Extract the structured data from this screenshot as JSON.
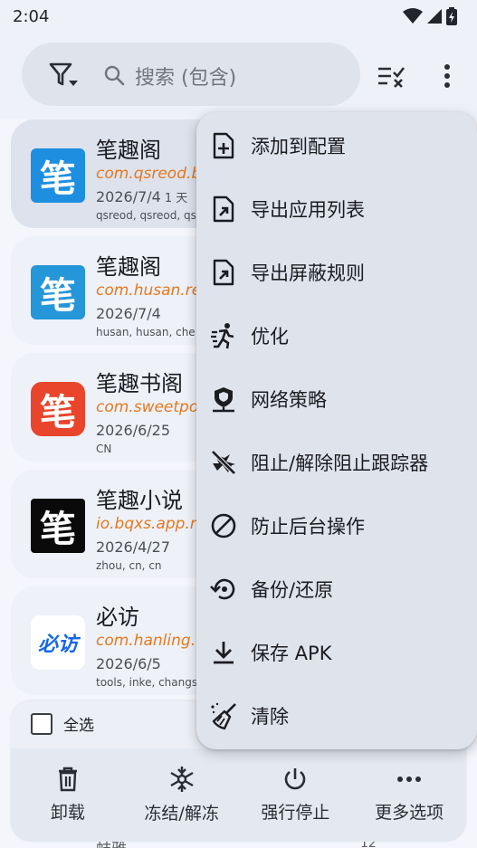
{
  "status_bar": {
    "time": "2:04"
  },
  "search": {
    "placeholder": "搜索 (包含)"
  },
  "apps": [
    {
      "name": "笔趣阁",
      "package": "com.qsreod.b",
      "date": "2026/7/4",
      "date_extra": "1 天",
      "tags": "qsreod, qsreod, qs",
      "icon_text": "笔",
      "icon_color": "#1e8fe0",
      "selected": true
    },
    {
      "name": "笔趣阁",
      "package": "com.husan.re",
      "date": "2026/7/4",
      "date_extra": "",
      "tags": "husan, husan, che",
      "icon_text": "笔",
      "icon_color": "#2596d8",
      "selected": false
    },
    {
      "name": "笔趣书阁",
      "package": "com.sweetpot",
      "date": "2026/6/25",
      "date_extra": "",
      "tags": "CN",
      "icon_text": "笔",
      "icon_color": "#e8452c",
      "selected": false
    },
    {
      "name": "笔趣小说",
      "package": "io.bqxs.app.re",
      "date": "2026/4/27",
      "date_extra": "",
      "tags": "zhou, cn, cn",
      "icon_text": "笔",
      "icon_color": "#0a0a0a",
      "selected": false
    },
    {
      "name": "必访",
      "package": "com.hanling.b",
      "date": "2026/6/5",
      "date_extra": "",
      "tags": "tools, inke, changs",
      "icon_text": "必访",
      "icon_color": "#ffffff",
      "selected": false
    }
  ],
  "bottom_bar": {
    "select_all": "全选",
    "actions": [
      {
        "label": "卸载",
        "icon": "trash-icon"
      },
      {
        "label": "冻结/解冻",
        "icon": "snowflake-icon"
      },
      {
        "label": "强行停止",
        "icon": "power-icon"
      },
      {
        "label": "更多选项",
        "icon": "more-horiz-icon"
      }
    ]
  },
  "behind": {
    "left_text": "蚌雅",
    "right_text": "12"
  },
  "menu": {
    "items": [
      {
        "label": "添加到配置",
        "icon": "add-file-icon"
      },
      {
        "label": "导出应用列表",
        "icon": "export-file-icon"
      },
      {
        "label": "导出屏蔽规则",
        "icon": "export-file-icon"
      },
      {
        "label": "优化",
        "icon": "running-icon"
      },
      {
        "label": "网络策略",
        "icon": "network-shield-icon"
      },
      {
        "label": "阻止/解除阻止跟踪器",
        "icon": "tracker-off-icon"
      },
      {
        "label": "防止后台操作",
        "icon": "block-icon"
      },
      {
        "label": "备份/还原",
        "icon": "restore-icon"
      },
      {
        "label": "保存 APK",
        "icon": "download-icon"
      },
      {
        "label": "清除",
        "icon": "broom-icon"
      }
    ]
  },
  "colors": {
    "accent_orange": "#e5791e",
    "menu_bg": "#dfe3ec",
    "card_bg": "#eef1f8"
  }
}
